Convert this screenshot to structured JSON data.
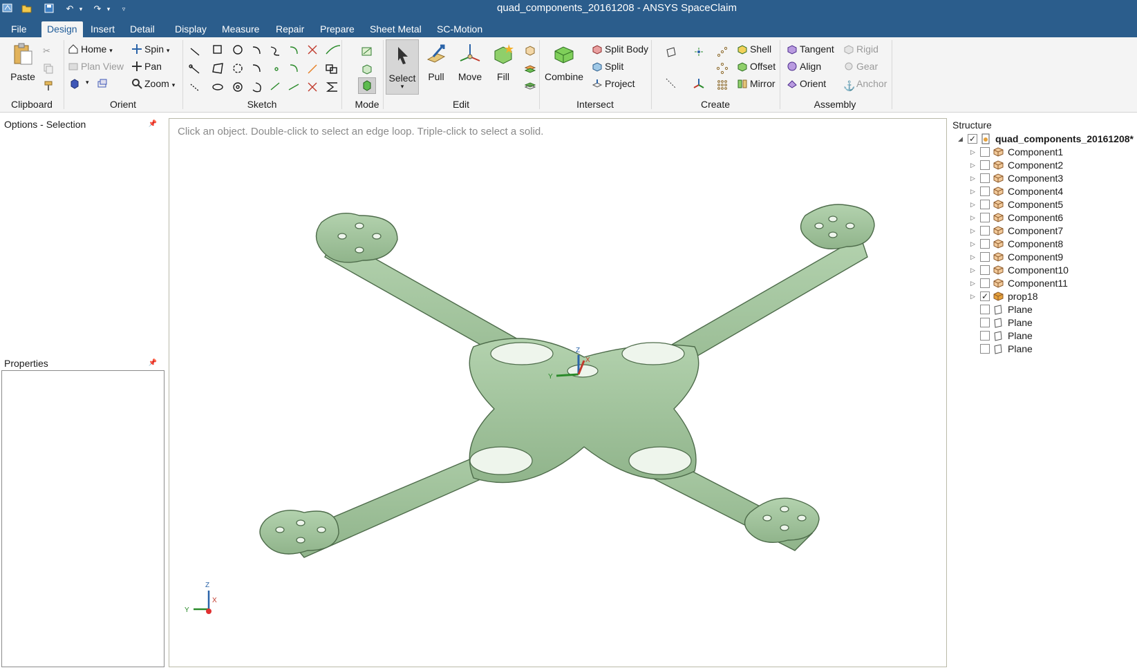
{
  "window": {
    "title": "quad_components_20161208 - ANSYS SpaceClaim"
  },
  "menu_tabs": [
    {
      "label": "File"
    },
    {
      "label": "Design"
    },
    {
      "label": "Insert"
    },
    {
      "label": "Detail"
    },
    {
      "label": "Display"
    },
    {
      "label": "Measure"
    },
    {
      "label": "Repair"
    },
    {
      "label": "Prepare"
    },
    {
      "label": "Sheet Metal"
    },
    {
      "label": "SC-Motion"
    }
  ],
  "ribbon": {
    "clipboard": {
      "label": "Clipboard",
      "paste": "Paste"
    },
    "orient": {
      "label": "Orient",
      "home": "Home",
      "spin": "Spin",
      "plan_view": "Plan View",
      "pan": "Pan",
      "zoom": "Zoom"
    },
    "sketch": {
      "label": "Sketch"
    },
    "mode": {
      "label": "Mode"
    },
    "edit": {
      "label": "Edit",
      "select": "Select",
      "pull": "Pull",
      "move": "Move",
      "fill": "Fill"
    },
    "intersect": {
      "label": "Intersect",
      "combine": "Combine",
      "split_body": "Split Body",
      "split": "Split",
      "project": "Project"
    },
    "create": {
      "label": "Create",
      "shell": "Shell",
      "offset": "Offset",
      "mirror": "Mirror"
    },
    "assembly": {
      "label": "Assembly",
      "tangent": "Tangent",
      "align": "Align",
      "orient": "Orient",
      "rigid": "Rigid",
      "gear": "Gear",
      "anchor": "Anchor"
    }
  },
  "panels": {
    "options": "Options - Selection",
    "properties": "Properties",
    "structure": "Structure"
  },
  "viewport": {
    "hint": "Click an object. Double-click to select an edge loop. Triple-click to select a solid.",
    "axis_labels": {
      "z": "Z",
      "y": "Y",
      "x": "X"
    }
  },
  "tree": {
    "root": "quad_components_20161208*",
    "items": [
      {
        "label": "Component1",
        "checked": false
      },
      {
        "label": "Component2",
        "checked": false
      },
      {
        "label": "Component3",
        "checked": false
      },
      {
        "label": "Component4",
        "checked": false
      },
      {
        "label": "Component5",
        "checked": false
      },
      {
        "label": "Component6",
        "checked": false
      },
      {
        "label": "Component7",
        "checked": false
      },
      {
        "label": "Component8",
        "checked": false
      },
      {
        "label": "Component9",
        "checked": false
      },
      {
        "label": "Component10",
        "checked": false
      },
      {
        "label": "Component11",
        "checked": false
      },
      {
        "label": "prop18",
        "checked": true
      },
      {
        "label": "Plane",
        "checked": false
      },
      {
        "label": "Plane",
        "checked": false
      },
      {
        "label": "Plane",
        "checked": false
      },
      {
        "label": "Plane",
        "checked": false
      }
    ]
  },
  "colors": {
    "titlebar": "#2b5d8c",
    "model_fill": "#9fc19b",
    "model_edge": "#4d6b4a"
  }
}
